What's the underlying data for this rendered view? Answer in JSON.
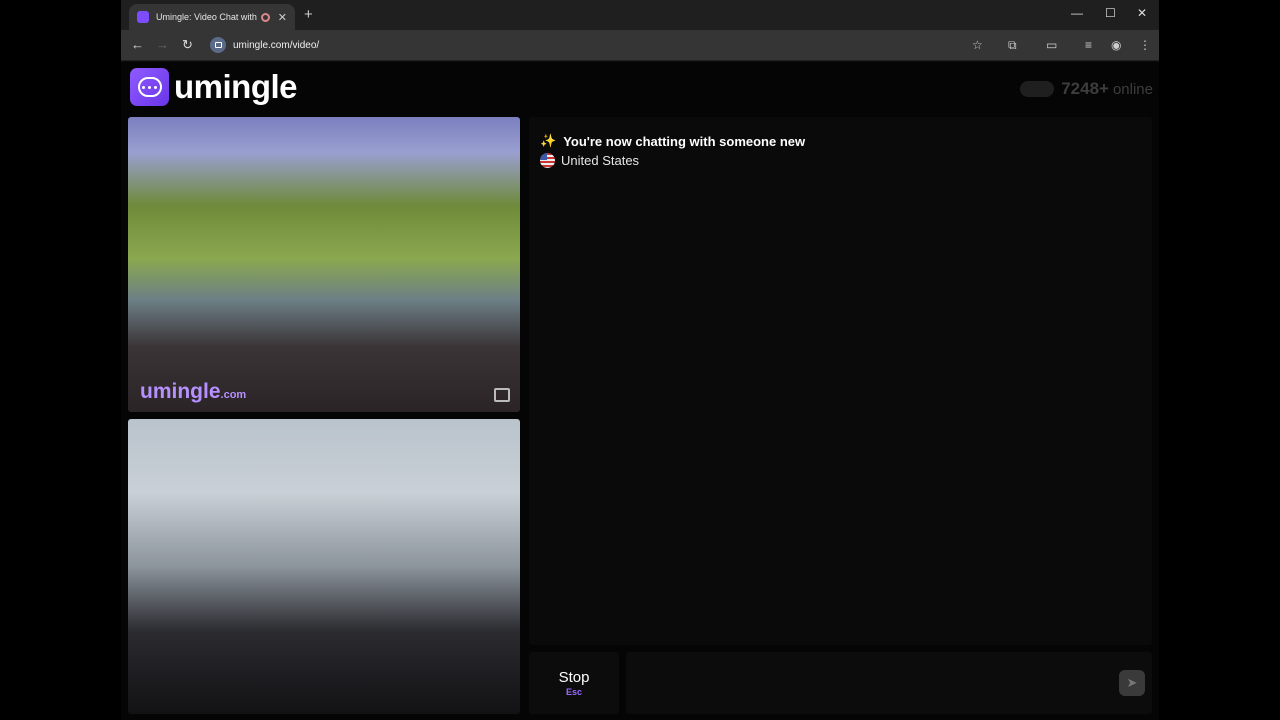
{
  "browser": {
    "tab_title": "Umingle: Video Chat with S",
    "url": "umingle.com/video/"
  },
  "header": {
    "logo_text": "umingle",
    "online_count": "7248+",
    "online_label": "online"
  },
  "video_top": {
    "watermark": "umingle",
    "watermark_suffix": ".com"
  },
  "chat": {
    "status": "You're now chatting with someone new",
    "country": "United States"
  },
  "controls": {
    "stop_label": "Stop",
    "stop_shortcut": "Esc"
  },
  "colors": {
    "brand": "#7c4dff",
    "accent_text": "#b690ff"
  }
}
